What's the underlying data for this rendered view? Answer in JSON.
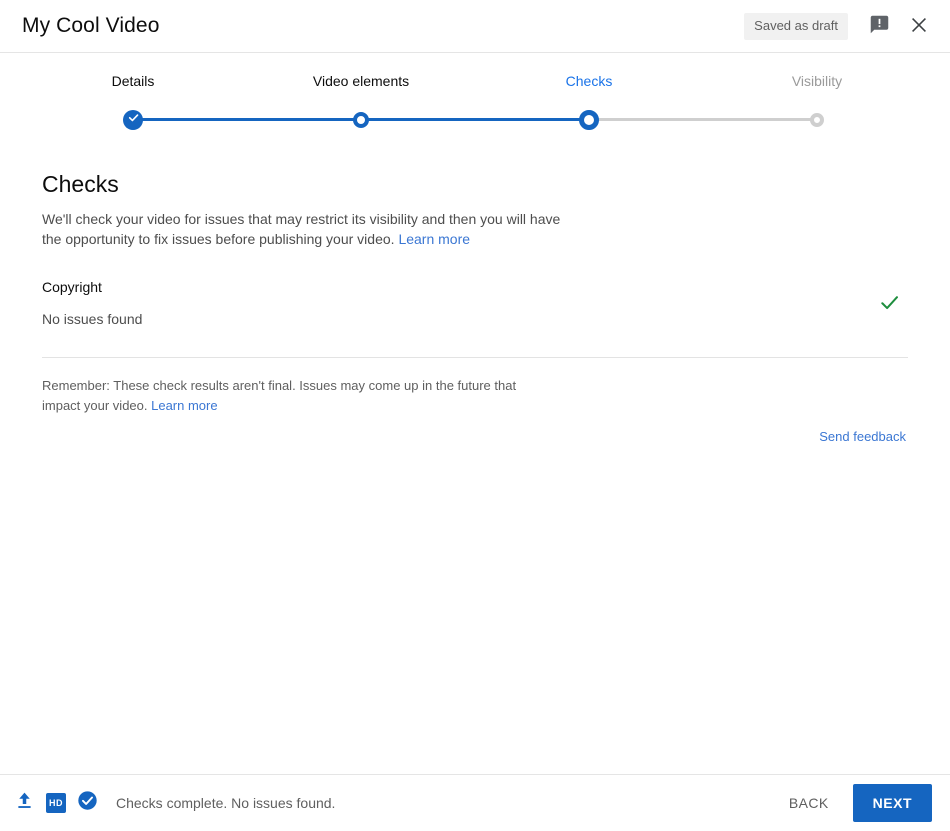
{
  "header": {
    "title": "My Cool Video",
    "saved_status": "Saved as draft",
    "feedback_icon": "feedback-bubble-icon",
    "close_icon": "close-icon"
  },
  "stepper": {
    "steps": [
      {
        "label": "Details",
        "state": "complete",
        "x_percent": 14.0
      },
      {
        "label": "Video elements",
        "state": "visited",
        "x_percent": 38.0
      },
      {
        "label": "Checks",
        "state": "active",
        "x_percent": 62.0
      },
      {
        "label": "Visibility",
        "state": "pending",
        "x_percent": 86.0
      }
    ],
    "accent_color": "#1565c0",
    "inactive_color": "#cfcfcf"
  },
  "main": {
    "heading": "Checks",
    "description_part1": "We'll check your video for issues that may restrict its visibility and then you will have the opportunity to fix issues before publishing your video. ",
    "description_link": "Learn more",
    "checks": [
      {
        "name": "Copyright",
        "status": "No issues found",
        "result_icon": "green-check-icon",
        "result_color": "#1e8e3e"
      }
    ],
    "remember_part1": "Remember: These check results aren't final. Issues may come up in the future that impact your video. ",
    "remember_link": "Learn more",
    "send_feedback": "Send feedback"
  },
  "footer": {
    "upload_icon": "upload-icon",
    "hd_badge": "HD",
    "checks_icon": "check-circle-icon",
    "status_text": "Checks complete. No issues found.",
    "back_label": "BACK",
    "next_label": "NEXT",
    "primary_color": "#1565c0"
  }
}
